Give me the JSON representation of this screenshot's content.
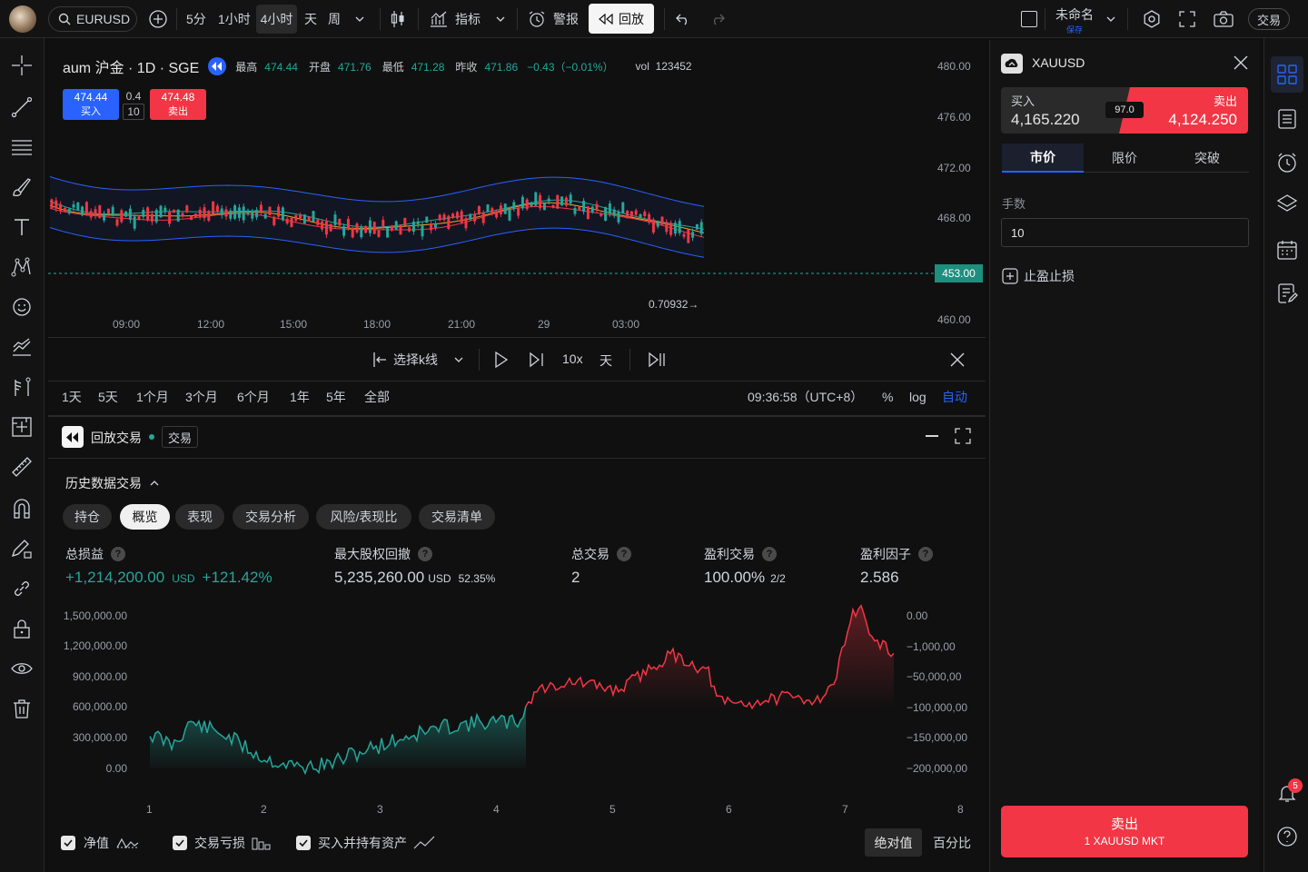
{
  "colors": {
    "up": "#26a69a",
    "down": "#f23645",
    "accent": "#2962ff",
    "sell": "#f23645",
    "buy_bg": "#2a2a2a"
  },
  "topbar": {
    "symbol": "EURUSD",
    "intervals": [
      "5分",
      "1小时",
      "4小时",
      "天",
      "周"
    ],
    "active_interval": "4小时",
    "indicators_label": "指标",
    "alert_label": "警报",
    "replay_label": "回放",
    "layout_name": "未命名",
    "layout_sub": "保存",
    "trade_label": "交易"
  },
  "chart": {
    "symbol_title": "aum 沪金 · 1D · SGE",
    "ohlc": [
      {
        "label": "最高",
        "value": "474.44"
      },
      {
        "label": "开盘",
        "value": "471.76"
      },
      {
        "label": "最低",
        "value": "471.28"
      },
      {
        "label": "昨收",
        "value": "471.86"
      }
    ],
    "change": "−0.43（−0.01%）",
    "vol_label": "vol",
    "vol_value": "123452",
    "buy_price": "474.44",
    "buy_label": "买入",
    "spread_top": "0.4",
    "spread_bottom": "10",
    "sell_price": "474.48",
    "sell_label": "卖出",
    "price_axis": [
      "480.00",
      "476.00",
      "472.00",
      "468.00",
      "460.00"
    ],
    "current_price": "453.00",
    "time_axis": [
      "09:00",
      "12:00",
      "15:00",
      "18:00",
      "21:00",
      "29",
      "03:00"
    ],
    "annotation": "0.70932→"
  },
  "replay": {
    "select_label": "选择k线",
    "speed": "10x",
    "unit": "天"
  },
  "ranges": {
    "items": [
      "1天",
      "5天",
      "1个月",
      "3个月",
      "6个月",
      "1年",
      "5年",
      "全部"
    ],
    "clock": "09:36:58（UTC+8）",
    "percent": "%",
    "log": "log",
    "auto": "自动"
  },
  "panel": {
    "title": "回放交易",
    "tag": "交易",
    "section": "历史数据交易",
    "tabs": [
      "持仓",
      "概览",
      "表现",
      "交易分析",
      "风险/表现比",
      "交易清单"
    ],
    "active_tab": "概览",
    "stats": [
      {
        "label": "总损益",
        "value": "+1,214,200.00",
        "unit": "USD",
        "extra": "+121.42%"
      },
      {
        "label": "最大股权回撤",
        "value": "5,235,260.00",
        "unit": "USD",
        "extra": "52.35%"
      },
      {
        "label": "总交易",
        "value": "2",
        "unit": "",
        "extra": ""
      },
      {
        "label": "盈利交易",
        "value": "100.00%",
        "unit": "",
        "extra": "2/2"
      },
      {
        "label": "盈利因子",
        "value": "2.586",
        "unit": "",
        "extra": ""
      }
    ],
    "y_left": [
      "1,500,000.00",
      "1,200,000.00",
      "900,000.00",
      "600,000.00",
      "300,000.00",
      "0.00"
    ],
    "y_right": [
      "0.00",
      "−1,000,00",
      "−50,000,00",
      "−100,000,00",
      "−150,000,00",
      "−200,000,00"
    ],
    "x_axis": [
      "1",
      "2",
      "3",
      "4",
      "5",
      "6",
      "7",
      "8"
    ],
    "legend": [
      "净值",
      "交易亏损",
      "买入并持有资产"
    ],
    "mode_abs": "绝对值",
    "mode_pct": "百分比"
  },
  "trade": {
    "symbol": "XAUUSD",
    "buy_label": "买入",
    "buy_price": "4,165.220",
    "spread": "97.0",
    "sell_label": "卖出",
    "sell_price": "4,124.250",
    "order_tabs": [
      "市价",
      "限价",
      "突破"
    ],
    "active_order_tab": "市价",
    "qty_label": "手数",
    "qty_value": "10",
    "tpsl_label": "止盈止损",
    "submit_main": "卖出",
    "submit_sub": "1 XAUUSD MKT"
  },
  "rightbar": {
    "notification_count": "5"
  }
}
